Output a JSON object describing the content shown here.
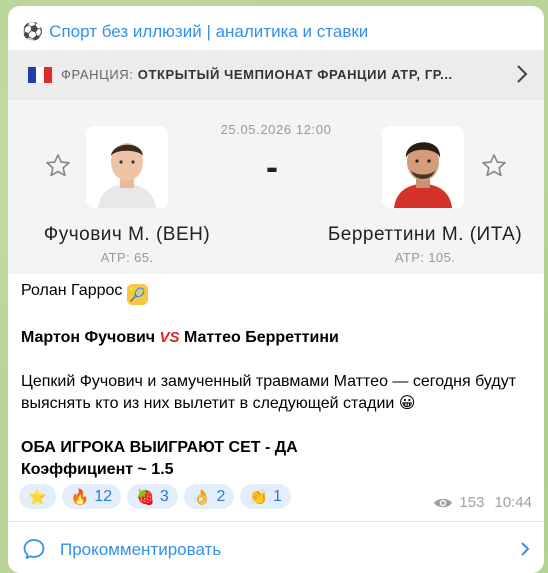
{
  "channel": {
    "icon": "soccer-ball-icon",
    "title": "Спорт без иллюзий | аналитика и ставки"
  },
  "tournament": {
    "flag": "france-flag-icon",
    "country": "ФРАНЦИЯ:",
    "name": "ОТКРЫТЫЙ ЧЕМПИОНАТ ФРАНЦИИ ATP, ГР...",
    "flag_colors": [
      "#1f3fa8",
      "#ffffff",
      "#e22a2a"
    ]
  },
  "match": {
    "datetime": "25.05.2026 12:00",
    "score": "-",
    "player1": {
      "name": "Фучович М. (ВЕН)",
      "rank": "ATP: 65."
    },
    "player2": {
      "name": "Берреттини М. (ИТА)",
      "rank": "ATP: 105."
    }
  },
  "post": {
    "line1": "Ролан Гаррос",
    "line1_emoji": "🎾",
    "matchup_a": "Мартон Фучович",
    "vs": "VS",
    "matchup_b": "Маттео Берреттини",
    "body": "Цепкий Фучович и замученный травмами Маттео — сегодня будут выяснять кто из них вылетит в следующей стадии",
    "body_emoji": "😀",
    "bet": "ОБА ИГРОКА ВЫИГРАЮТ СЕТ - ДА",
    "odds": "Коэффициент ~ 1.5"
  },
  "reactions": [
    {
      "emoji": "⭐",
      "count": ""
    },
    {
      "emoji": "🔥",
      "count": "12"
    },
    {
      "emoji": "🍓",
      "count": "3"
    },
    {
      "emoji": "👌",
      "count": "2"
    },
    {
      "emoji": "👏",
      "count": "1"
    }
  ],
  "meta": {
    "views": "153",
    "time": "10:44"
  },
  "comment": {
    "label": "Прокомментировать"
  },
  "colors": {
    "accent": "#3390ec",
    "reaction_bg": "#e3eefa"
  }
}
